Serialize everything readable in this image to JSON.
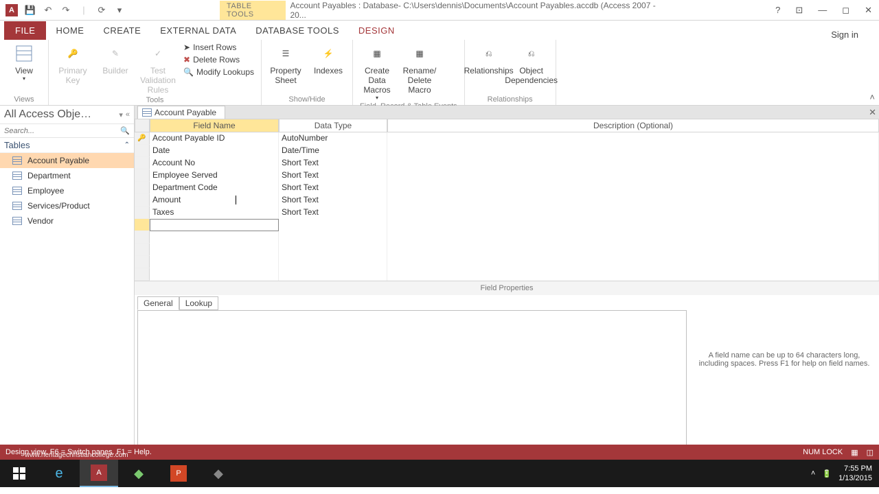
{
  "titlebar": {
    "context_tab": "TABLE TOOLS",
    "title": "Account Payables : Database- C:\\Users\\dennis\\Documents\\Account Payables.accdb (Access 2007 - 20..."
  },
  "ribbon_tabs": {
    "file": "FILE",
    "home": "HOME",
    "create": "CREATE",
    "external": "EXTERNAL DATA",
    "dbtools": "DATABASE TOOLS",
    "design": "DESIGN",
    "signin": "Sign in"
  },
  "ribbon": {
    "views": {
      "view": "View",
      "group": "Views"
    },
    "tools": {
      "primary_key": "Primary Key",
      "builder": "Builder",
      "test": "Test Validation Rules",
      "insert_rows": "Insert Rows",
      "delete_rows": "Delete Rows",
      "modify_lookups": "Modify Lookups",
      "group": "Tools"
    },
    "showhide": {
      "property_sheet": "Property Sheet",
      "indexes": "Indexes",
      "group": "Show/Hide"
    },
    "events": {
      "create_macros": "Create Data Macros",
      "rename_delete": "Rename/ Delete Macro",
      "group": "Field, Record & Table Events"
    },
    "relationships": {
      "relationships": "Relationships",
      "dependencies": "Object Dependencies",
      "group": "Relationships"
    }
  },
  "nav": {
    "title": "All Access Obje…",
    "search_placeholder": "Search...",
    "group": "Tables",
    "items": [
      "Account Payable",
      "Department",
      "Employee",
      "Services/Product",
      "Vendor"
    ]
  },
  "doc": {
    "tab": "Account Payable",
    "headers": {
      "field_name": "Field Name",
      "data_type": "Data Type",
      "description": "Description (Optional)"
    },
    "rows": [
      {
        "pk": true,
        "name": "Account Payable ID",
        "type": "AutoNumber"
      },
      {
        "pk": false,
        "name": "Date",
        "type": "Date/Time"
      },
      {
        "pk": false,
        "name": "Account No",
        "type": "Short Text"
      },
      {
        "pk": false,
        "name": "Employee Served",
        "type": "Short Text"
      },
      {
        "pk": false,
        "name": "Department Code",
        "type": "Short Text"
      },
      {
        "pk": false,
        "name": "Amount",
        "type": "Short Text"
      },
      {
        "pk": false,
        "name": "Taxes",
        "type": "Short Text"
      }
    ],
    "field_props": "Field Properties",
    "tabs": {
      "general": "General",
      "lookup": "Lookup"
    },
    "hint": "A field name can be up to 64 characters long, including spaces. Press F1 for help on field names."
  },
  "status": {
    "left": "Design view.  F6 = Switch panes.  F1 = Help.",
    "numlock": "NUM LOCK",
    "watermark": "www.heritagechristiancollege.com"
  },
  "taskbar": {
    "time": "7:55 PM",
    "date": "1/13/2015"
  }
}
